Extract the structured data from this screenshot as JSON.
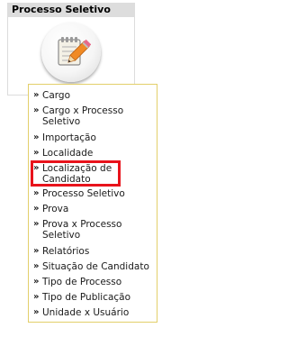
{
  "module": {
    "title": "Processo Seletivo",
    "icon": "notepad-pencil-icon"
  },
  "menu": {
    "bullet": "»",
    "items": [
      {
        "label": "Cargo"
      },
      {
        "label": "Cargo x Processo\nSeletivo"
      },
      {
        "label": "Importação"
      },
      {
        "label": "Localidade"
      },
      {
        "label": "Localização de\nCandidato"
      },
      {
        "label": "Processo Seletivo"
      },
      {
        "label": "Prova"
      },
      {
        "label": "Prova x Processo\nSeletivo"
      },
      {
        "label": "Relatórios"
      },
      {
        "label": "Situação de Candidato"
      },
      {
        "label": "Tipo de Processo"
      },
      {
        "label": "Tipo de Publicação"
      },
      {
        "label": "Unidade x Usuário"
      }
    ]
  },
  "highlight": {
    "item": "Localização de Candidato",
    "color": "#e8131b"
  },
  "colors": {
    "header_bg": "#dddddd",
    "menu_border": "#e3cf6a"
  }
}
